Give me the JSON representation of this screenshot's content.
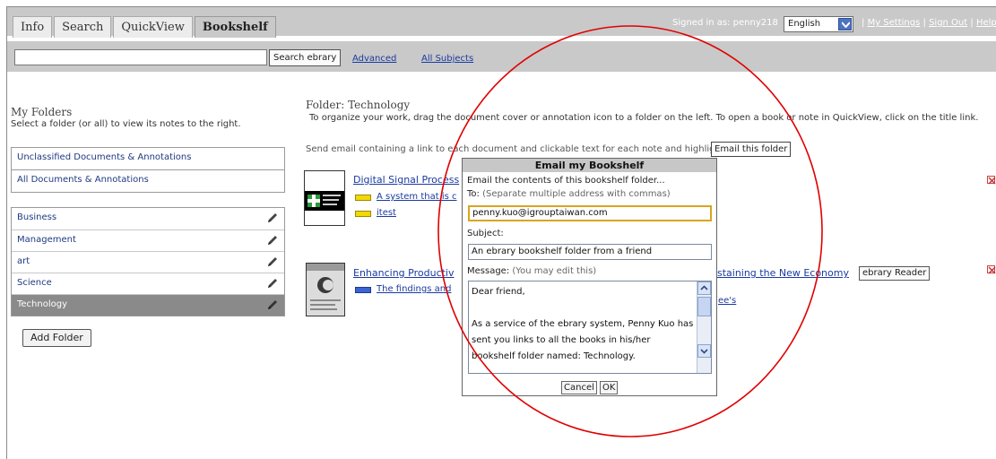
{
  "tabs": [
    {
      "label": "Info"
    },
    {
      "label": "Search"
    },
    {
      "label": "QuickView"
    },
    {
      "label": "Bookshelf"
    }
  ],
  "header": {
    "signed_in": "Signed in as: penny218",
    "language": "English",
    "links": {
      "my_settings": "My Settings",
      "sign_out": "Sign Out",
      "help": "Help"
    },
    "separator": "|"
  },
  "search": {
    "value": "",
    "button_label": "Search ebrary",
    "advanced_label": "Advanced",
    "all_subjects_label": "All Subjects"
  },
  "sidebar": {
    "title": "My Folders",
    "description": "Select a folder (or all) to view its notes to the right.",
    "top_items": [
      {
        "label": "Unclassified Documents & Annotations"
      },
      {
        "label": "All Documents & Annotations"
      }
    ],
    "folders": [
      {
        "label": "Business"
      },
      {
        "label": "Management"
      },
      {
        "label": "art"
      },
      {
        "label": "Science"
      },
      {
        "label": "Technology",
        "selected": true
      }
    ],
    "add_folder_label": "Add Folder"
  },
  "main": {
    "folder_title": "Folder: Technology",
    "instructions": "To organize your work, drag the document cover or annotation icon to a folder on the left. To open a book or note in QuickView, click on the title link.",
    "send_email_text": "Send email containing a link to each document and clickable text for each note and highlight",
    "email_button_label": "Email this folder",
    "documents": [
      {
        "title": "Digital Signal Process",
        "notes": [
          {
            "text": "A system that is c",
            "icon": "yellow-highlight-icon"
          },
          {
            "text": "itest",
            "icon": "yellow-note-icon"
          }
        ]
      },
      {
        "title": "Enhancing Productiv",
        "title_end": "ustaining the New Economy",
        "reader_button": "ebrary Reader",
        "notes": [
          {
            "text": "The findings and",
            "text_end": "ee's",
            "icon": "blue-highlight-icon"
          }
        ]
      }
    ]
  },
  "dialog": {
    "title": "Email my Bookshelf",
    "intro": "Email the contents of this bookshelf folder...",
    "to_label": "To:",
    "to_note": "(Separate multiple address with commas)",
    "to_value": "penny.kuo@igrouptaiwan.com",
    "subject_label": "Subject:",
    "subject_value": "An ebrary bookshelf folder from a friend",
    "message_label": "Message:",
    "message_note": "(You may edit this)",
    "message_lines": [
      "Dear friend,",
      "As a service of the ebrary system, Penny Kuo has sent you links to all the books in his/her bookshelf folder named: Technology."
    ],
    "cancel_label": "Cancel",
    "ok_label": "OK"
  },
  "colors": {
    "toolbar_gray": "#c9c9c9",
    "selected_folder": "#8a8a8a",
    "link_blue": "#1a3aa0",
    "annotation_circle": "#e00000"
  }
}
